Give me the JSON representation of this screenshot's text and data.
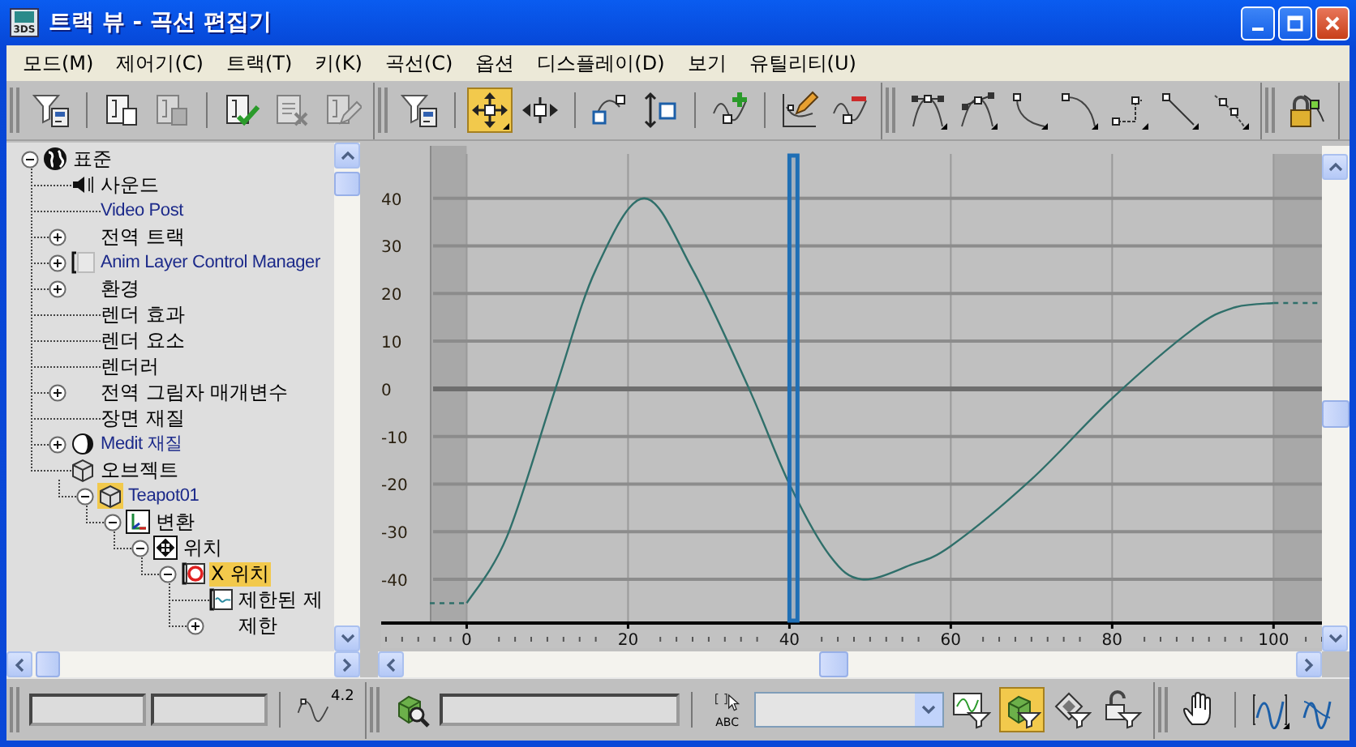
{
  "window": {
    "title": "트랙 뷰 - 곡선 편집기",
    "app_icon_label": "3DS"
  },
  "menu": [
    "모드(M)",
    "제어기(C)",
    "트랙(T)",
    "키(K)",
    "곡선(C)",
    "옵션",
    "디스플레이(D)",
    "보기",
    "유틸리티(U)"
  ],
  "toolbar": [
    [
      [
        {
          "kind": "filter",
          "pressed": false,
          "disabled": false
        }
      ],
      [
        {
          "kind": "copy",
          "pressed": false,
          "disabled": false
        },
        {
          "kind": "paste",
          "pressed": false,
          "disabled": true
        }
      ],
      [
        {
          "kind": "assign",
          "pressed": false,
          "disabled": false
        },
        {
          "kind": "delete",
          "pressed": false,
          "disabled": true
        },
        {
          "kind": "properties",
          "pressed": false,
          "disabled": true
        }
      ]
    ],
    [
      [
        {
          "kind": "filter",
          "pressed": false,
          "disabled": false
        }
      ],
      [
        {
          "kind": "move",
          "pressed": true,
          "disabled": false
        },
        {
          "kind": "slide",
          "pressed": false,
          "disabled": false
        }
      ],
      [
        {
          "kind": "scale-time",
          "pressed": false,
          "disabled": false
        },
        {
          "kind": "scale-values",
          "pressed": false,
          "disabled": false
        }
      ],
      [
        {
          "kind": "add-keys",
          "pressed": false,
          "disabled": false
        }
      ],
      [
        {
          "kind": "draw-curves",
          "pressed": false,
          "disabled": false
        },
        {
          "kind": "reduce-keys",
          "pressed": false,
          "disabled": false
        }
      ]
    ],
    [
      [
        {
          "kind": "tan-auto",
          "pressed": false,
          "disabled": false
        },
        {
          "kind": "tan-custom",
          "pressed": false,
          "disabled": false
        },
        {
          "kind": "tan-fast",
          "pressed": false,
          "disabled": false
        },
        {
          "kind": "tan-slow",
          "pressed": false,
          "disabled": false
        },
        {
          "kind": "tan-step",
          "pressed": false,
          "disabled": false
        },
        {
          "kind": "tan-linear",
          "pressed": false,
          "disabled": false
        },
        {
          "kind": "tan-smooth",
          "pressed": false,
          "disabled": false
        }
      ]
    ],
    [
      [
        {
          "kind": "lock",
          "pressed": false,
          "disabled": false
        }
      ]
    ]
  ],
  "tree": [
    {
      "label": "표준",
      "kind": "root",
      "expanded": true,
      "selected": false,
      "children": [
        {
          "label": "사운드",
          "kind": "sound",
          "selected": false
        },
        {
          "label": "Video Post",
          "kind": "video-post",
          "selected": false
        },
        {
          "label": "전역 트랙",
          "kind": "plain",
          "expanded": false,
          "selected": false
        },
        {
          "label": "Anim Layer Control Manager",
          "kind": "layer-manager",
          "expanded": false,
          "selected": false
        },
        {
          "label": "환경",
          "kind": "plain",
          "expanded": false,
          "selected": false
        },
        {
          "label": "렌더 효과",
          "kind": "plain",
          "selected": false
        },
        {
          "label": "렌더 요소",
          "kind": "plain",
          "selected": false
        },
        {
          "label": "렌더러",
          "kind": "plain",
          "selected": false
        },
        {
          "label": "전역 그림자 매개변수",
          "kind": "plain",
          "expanded": false,
          "selected": false
        },
        {
          "label": "장면 재질",
          "kind": "plain",
          "selected": false
        },
        {
          "label": "Medit 재질",
          "kind": "materials",
          "expanded": false,
          "selected": false
        },
        {
          "label": "오브젝트",
          "kind": "objects",
          "selected": false,
          "children": [
            {
              "label": "Teapot01",
              "kind": "object",
              "expanded": true,
              "selected": true,
              "children": [
                {
                  "label": "변환",
                  "kind": "transform",
                  "expanded": true,
                  "selected": false,
                  "children": [
                    {
                      "label": "위치",
                      "kind": "position",
                      "expanded": true,
                      "selected": false,
                      "children": [
                        {
                          "label": "X 위치",
                          "kind": "controller",
                          "expanded": true,
                          "selected": true,
                          "children": [
                            {
                              "label": "제한된 제",
                              "kind": "curve",
                              "selected": false
                            },
                            {
                              "label": "제한",
                              "kind": "plain",
                              "expanded": false,
                              "selected": false
                            }
                          ]
                        }
                      ]
                    }
                  ]
                }
              ]
            }
          ]
        }
      ]
    }
  ],
  "curve_editor": {
    "chart_data": {
      "type": "line",
      "x": [
        0,
        5,
        11,
        16,
        22,
        28,
        35,
        40,
        45,
        49,
        55,
        60,
        70,
        80,
        90,
        95,
        100
      ],
      "series": [
        {
          "color": "#2f6f6a",
          "values": [
            -45,
            -31,
            0,
            25,
            40,
            25,
            0,
            -20,
            -35,
            -40,
            -37,
            -33,
            -19,
            -2,
            12.5,
            17,
            18
          ]
        }
      ],
      "xlim": [
        -11,
        106
      ],
      "ylim": [
        -49,
        51
      ],
      "xticks": [
        0,
        20,
        40,
        60,
        80,
        100
      ],
      "yticks": [
        -40,
        -30,
        -20,
        -10,
        0,
        10,
        20,
        30,
        40
      ],
      "grid": true,
      "bands": [
        {
          "axis": "x",
          "from": 40,
          "to": 41
        }
      ]
    }
  },
  "bottom_toolbar": [
    [
      [
        {
          "kind": "field"
        },
        {
          "kind": "field"
        }
      ],
      [
        {
          "kind": "curve-value",
          "label": "4.2",
          "pressed": false
        }
      ]
    ],
    [
      [
        {
          "kind": "zoom-selected",
          "pressed": false
        },
        {
          "kind": "wide-field"
        }
      ],
      [
        {
          "kind": "select-name",
          "label": "ABC",
          "pressed": false
        },
        {
          "kind": "dropdown"
        },
        {
          "kind": "filter-curves",
          "pressed": false
        },
        {
          "kind": "filter-selected",
          "pressed": true
        },
        {
          "kind": "filter-animated",
          "pressed": false
        },
        {
          "kind": "filter-unlocked",
          "pressed": false
        }
      ]
    ],
    [
      [
        {
          "kind": "pan",
          "pressed": false
        }
      ],
      [
        {
          "kind": "zoom-horizontal",
          "pressed": false
        },
        {
          "kind": "zoom-value",
          "pressed": false
        }
      ]
    ]
  ]
}
